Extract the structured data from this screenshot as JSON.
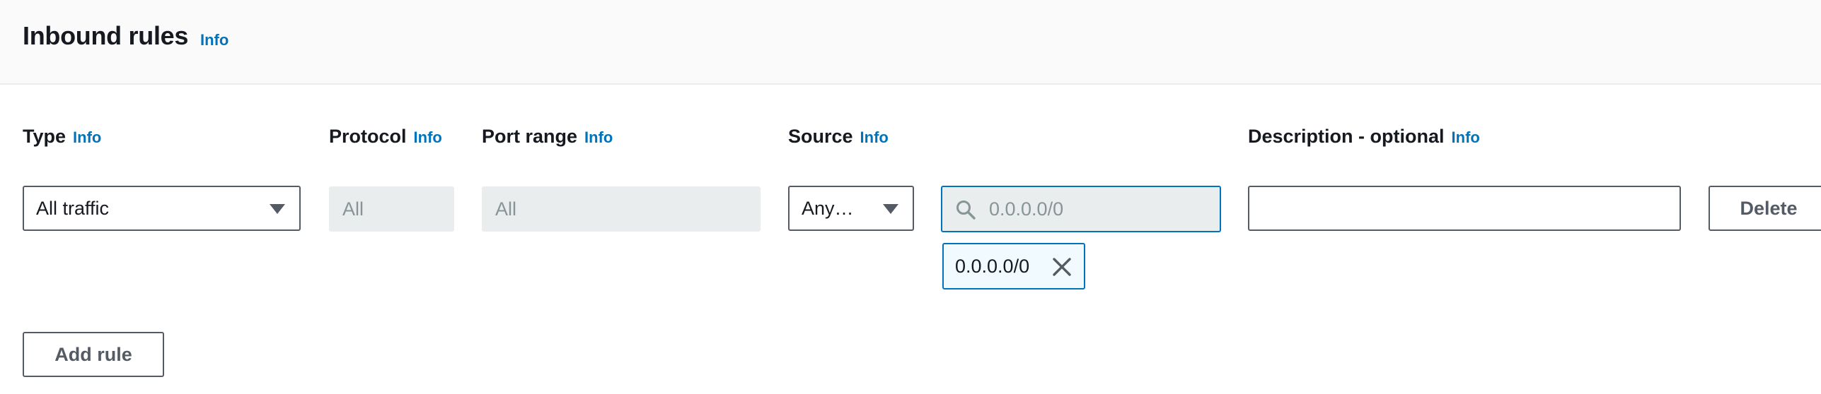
{
  "section": {
    "title": "Inbound rules",
    "info_label": "Info"
  },
  "columns": {
    "type": {
      "label": "Type",
      "info": "Info"
    },
    "protocol": {
      "label": "Protocol",
      "info": "Info"
    },
    "port_range": {
      "label": "Port range",
      "info": "Info"
    },
    "source": {
      "label": "Source",
      "info": "Info"
    },
    "description": {
      "label": "Description - optional",
      "info": "Info"
    }
  },
  "rule": {
    "type_value": "All traffic",
    "protocol_value": "All",
    "port_range_value": "All",
    "source_select_value": "Any…",
    "source_search_placeholder": "0.0.0.0/0",
    "source_token": "0.0.0.0/0",
    "description_value": "",
    "delete_label": "Delete"
  },
  "actions": {
    "add_rule_label": "Add rule"
  },
  "icons": {
    "dropdown": "caret-down-icon",
    "search": "search-icon",
    "remove": "close-icon"
  },
  "colors": {
    "link": "#0073bb",
    "border": "#545b64",
    "disabled_bg": "#eaeded",
    "token_bg": "#f1faff"
  }
}
